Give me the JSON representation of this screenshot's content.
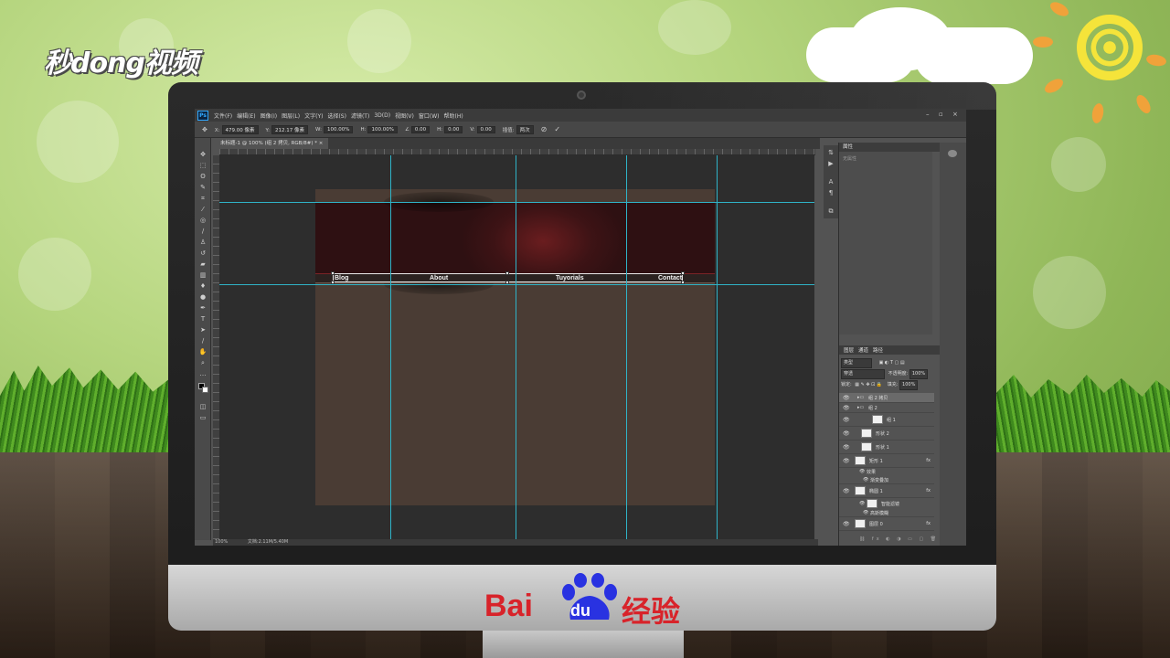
{
  "watermark": {
    "logo_text": "秒dong视频",
    "brand_left": "Bai",
    "brand_paw": "du",
    "brand_right": "经验"
  },
  "photoshop": {
    "app_icon": "Ps",
    "menu": [
      "文件(F)",
      "编辑(E)",
      "图像(I)",
      "图层(L)",
      "文字(Y)",
      "选择(S)",
      "滤镜(T)",
      "3D(D)",
      "视图(V)",
      "窗口(W)",
      "帮助(H)"
    ],
    "window_controls": [
      "–",
      "▫",
      "×"
    ],
    "options": {
      "x_label": "X:",
      "x_value": "479.00 像素",
      "y_label": "Y:",
      "y_value": "212.17 像素",
      "w_label": "W:",
      "w_value": "100.00%",
      "h_label": "H:",
      "h_value": "100.00%",
      "angle_value": "0.00",
      "h2_label": "H:",
      "h2_value": "0.00",
      "v_label": "V:",
      "v_value": "0.00",
      "interp_label": "插值:",
      "interp_value": "两次"
    },
    "doc_tab": "未标题-1 @ 100% (组 2 拷贝, RGB/8#) *  ×",
    "canvas": {
      "nav_links": [
        "Blog",
        "About",
        "Tuyorials",
        "Contact"
      ],
      "guide_color": "#2fb3c7",
      "banner_color": "#6a1d1f",
      "doc_color": "#4a3c34"
    },
    "statusbar": {
      "zoom": "100%",
      "doc_info": "文档:2.11M/5.40M"
    },
    "properties_panel": {
      "title": "属性",
      "empty_text": "无属性"
    },
    "layers_panel": {
      "tabs": [
        "图层",
        "通道",
        "路径"
      ],
      "search_placeholder": "类型",
      "blend_mode": "穿透",
      "opacity_label": "不透明度:",
      "opacity_value": "100%",
      "lock_label": "锁定:",
      "fill_label": "填充:",
      "fill_value": "100%",
      "layers": [
        {
          "name": "组 2 拷贝",
          "type": "group"
        },
        {
          "name": "组 2",
          "type": "group"
        },
        {
          "name": "组 1",
          "type": "group"
        },
        {
          "name": "形状 2",
          "type": "shape"
        },
        {
          "name": "形状 1",
          "type": "shape"
        },
        {
          "name": "矩形 1",
          "type": "shape",
          "fx": "fx"
        },
        {
          "name": "效果",
          "type": "effect"
        },
        {
          "name": "渐变叠加",
          "type": "effect"
        },
        {
          "name": "椭圆 1",
          "type": "smart",
          "fx": "fx"
        },
        {
          "name": "智能滤镜",
          "type": "effect"
        },
        {
          "name": "高斯模糊",
          "type": "effect"
        },
        {
          "name": "图层 0",
          "type": "pixel",
          "fx": "fx"
        }
      ]
    }
  }
}
